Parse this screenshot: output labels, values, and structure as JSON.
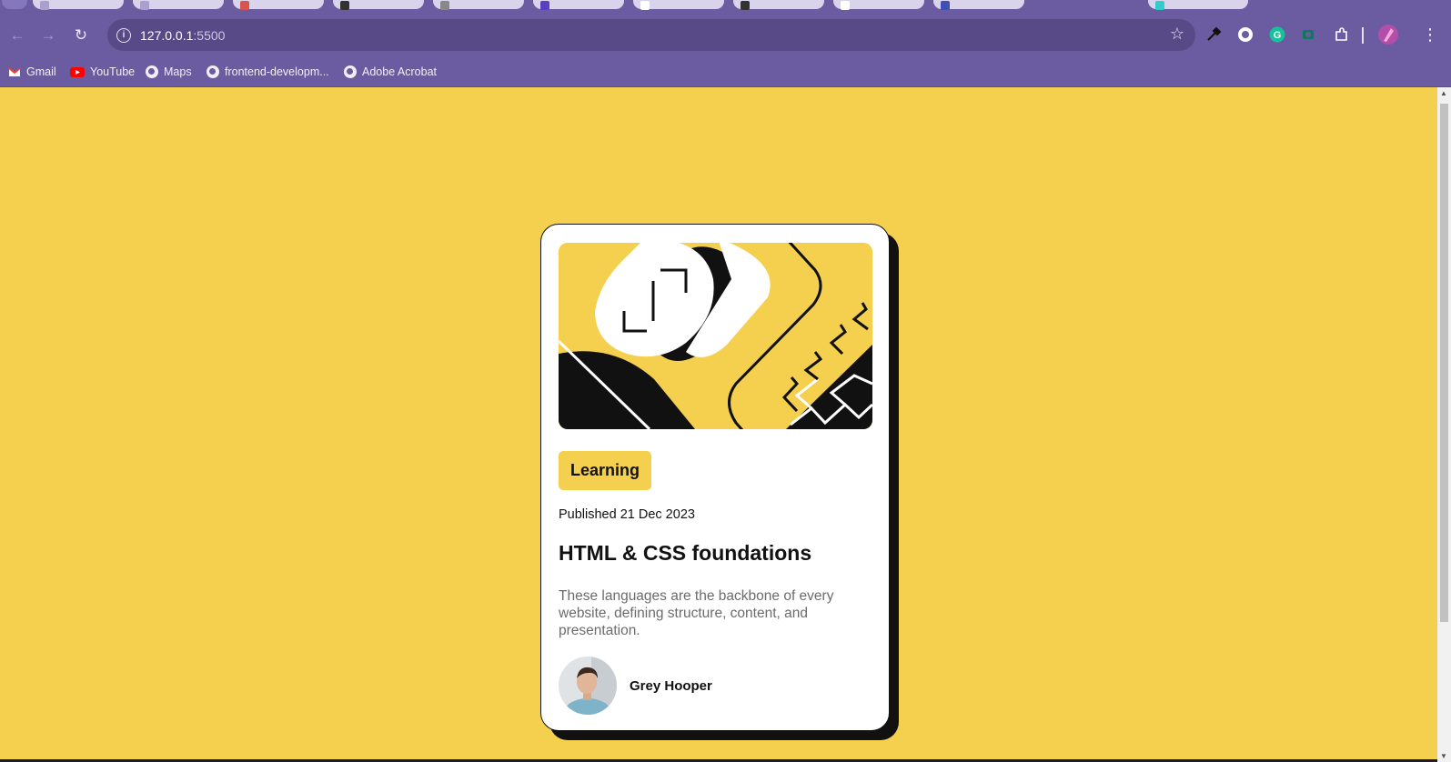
{
  "browser": {
    "url_host": "127.0.0.1",
    "url_port": ":5500",
    "bookmarks": [
      {
        "label": "Gmail",
        "icon": "gmail-icon"
      },
      {
        "label": "YouTube",
        "icon": "youtube-icon"
      },
      {
        "label": "Maps",
        "icon": "globe-icon"
      },
      {
        "label": "frontend-developm...",
        "icon": "globe-icon"
      },
      {
        "label": "Adobe Acrobat",
        "icon": "globe-icon"
      }
    ]
  },
  "card": {
    "tag": "Learning",
    "published": "Published 21 Dec 2023",
    "title": "HTML & CSS foundations",
    "description": "These languages are the backbone of every website, defining structure, content, and presentation.",
    "author": "Grey Hooper"
  },
  "colors": {
    "background": "#f4d04e",
    "card": "#ffffff",
    "text": "#111111",
    "muted_text": "#6b6b6b",
    "browser_frame": "#6b5ba0"
  }
}
